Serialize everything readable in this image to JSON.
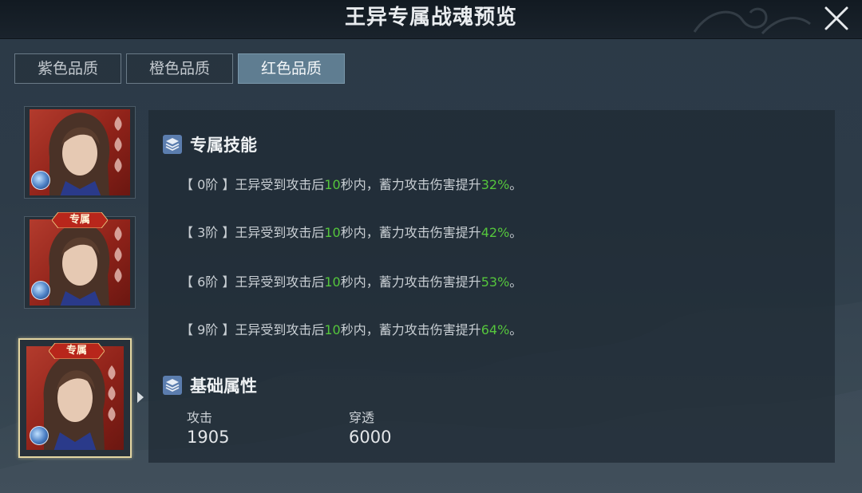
{
  "window": {
    "title": "王异专属战魂预览"
  },
  "tabs": [
    {
      "label": "紫色品质",
      "active": false
    },
    {
      "label": "橙色品质",
      "active": false
    },
    {
      "label": "红色品质",
      "active": true
    }
  ],
  "portraits": [
    {
      "badge": "",
      "selected": false
    },
    {
      "badge": "专属",
      "selected": false
    },
    {
      "badge": "专属",
      "selected": true
    }
  ],
  "skills": {
    "title": "专属技能",
    "lines": [
      {
        "prefix": "【 0阶 】王异受到攻击后",
        "seconds": "10",
        "mid": "秒内，蓄力攻击伤害提升",
        "percent": "32%",
        "suffix": "。"
      },
      {
        "prefix": "【 3阶 】王异受到攻击后",
        "seconds": "10",
        "mid": "秒内，蓄力攻击伤害提升",
        "percent": "42%",
        "suffix": "。"
      },
      {
        "prefix": "【 6阶 】王异受到攻击后",
        "seconds": "10",
        "mid": "秒内，蓄力攻击伤害提升",
        "percent": "53%",
        "suffix": "。"
      },
      {
        "prefix": "【 9阶 】王异受到攻击后",
        "seconds": "10",
        "mid": "秒内，蓄力攻击伤害提升",
        "percent": "64%",
        "suffix": "。"
      }
    ]
  },
  "attributes": {
    "title": "基础属性",
    "items": [
      {
        "label": "攻击",
        "value": "1905"
      },
      {
        "label": "穿透",
        "value": "6000"
      }
    ]
  },
  "colors": {
    "highlight": "#55c63c",
    "active_tab": "#5f7d91",
    "selected_border": "#e3d6a2",
    "portrait_bg": "#9a2a1f"
  }
}
